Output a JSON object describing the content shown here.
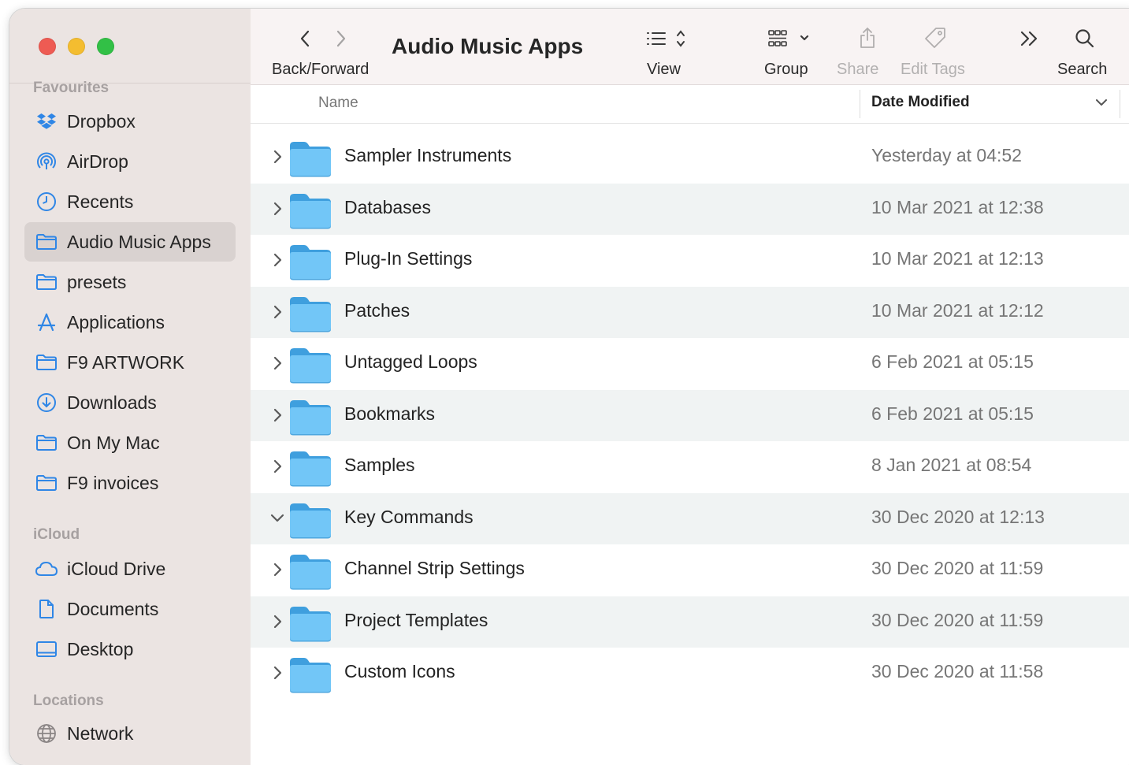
{
  "window": {
    "title": "Audio Music Apps"
  },
  "toolbar": {
    "back_forward_label": "Back/Forward",
    "view_label": "View",
    "group_label": "Group",
    "share_label": "Share",
    "edit_tags_label": "Edit Tags",
    "search_label": "Search"
  },
  "sidebar": {
    "favourites_title": "Favourites",
    "icloud_title": "iCloud",
    "locations_title": "Locations",
    "favourites": [
      {
        "label": "Dropbox",
        "icon": "dropbox-icon"
      },
      {
        "label": "AirDrop",
        "icon": "airdrop-icon"
      },
      {
        "label": "Recents",
        "icon": "clock-icon"
      },
      {
        "label": "Audio Music Apps",
        "icon": "folder-icon",
        "selected": true
      },
      {
        "label": "presets",
        "icon": "folder-icon"
      },
      {
        "label": "Applications",
        "icon": "applications-icon"
      },
      {
        "label": "F9 ARTWORK",
        "icon": "folder-icon"
      },
      {
        "label": "Downloads",
        "icon": "download-icon"
      },
      {
        "label": "On My Mac",
        "icon": "folder-icon"
      },
      {
        "label": "F9 invoices",
        "icon": "folder-icon"
      }
    ],
    "icloud": [
      {
        "label": "iCloud Drive",
        "icon": "cloud-icon"
      },
      {
        "label": "Documents",
        "icon": "document-icon"
      },
      {
        "label": "Desktop",
        "icon": "desktop-icon"
      }
    ],
    "locations": [
      {
        "label": "Network",
        "icon": "network-icon"
      }
    ]
  },
  "columns": {
    "name": "Name",
    "date_modified": "Date Modified"
  },
  "files": [
    {
      "name": "Sampler Instruments",
      "date": "Yesterday at 04:52",
      "expanded": false
    },
    {
      "name": "Databases",
      "date": "10 Mar 2021 at 12:38",
      "expanded": false
    },
    {
      "name": "Plug-In Settings",
      "date": "10 Mar 2021 at 12:13",
      "expanded": false
    },
    {
      "name": "Patches",
      "date": "10 Mar 2021 at 12:12",
      "expanded": false
    },
    {
      "name": "Untagged Loops",
      "date": "6 Feb 2021 at 05:15",
      "expanded": false
    },
    {
      "name": "Bookmarks",
      "date": "6 Feb 2021 at 05:15",
      "expanded": false
    },
    {
      "name": "Samples",
      "date": "8 Jan 2021 at 08:54",
      "expanded": false
    },
    {
      "name": "Key Commands",
      "date": "30 Dec 2020 at 12:13",
      "expanded": true
    },
    {
      "name": "Channel Strip Settings",
      "date": "30 Dec 2020 at 11:59",
      "expanded": false
    },
    {
      "name": "Project Templates",
      "date": "30 Dec 2020 at 11:59",
      "expanded": false
    },
    {
      "name": "Custom Icons",
      "date": "30 Dec 2020 at 11:58",
      "expanded": false
    }
  ],
  "colors": {
    "accent": "#2f86e6",
    "sidebar_bg": "#ebe4e2",
    "folder": "#6cc3f5"
  }
}
